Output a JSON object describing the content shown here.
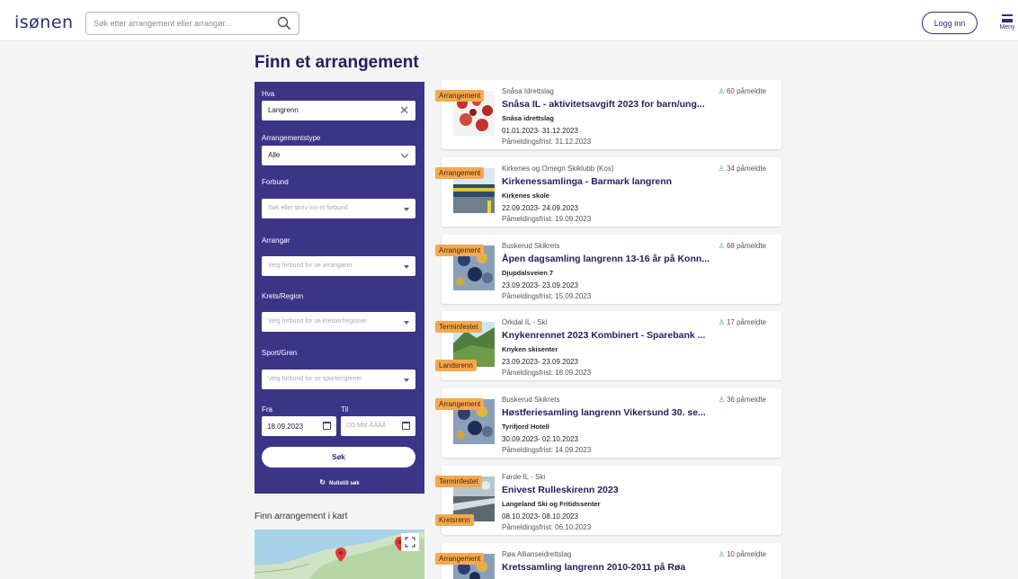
{
  "header": {
    "logo": "isønen",
    "search_placeholder": "Søk etter arrangement eller arrangør...",
    "login_label": "Logg inn",
    "menu_label": "Meny"
  },
  "page": {
    "title": "Finn et arrangement",
    "map_title": "Finn arrangement i kart"
  },
  "filters": {
    "hva_label": "Hva",
    "hva_value": "Langrenn",
    "type_label": "Arrangementstype",
    "type_value": "Alle",
    "forbund_label": "Forbund",
    "forbund_placeholder": "Søk eller skriv inn et forbund",
    "arrangor_label": "Arrangør",
    "arrangor_placeholder": "Velg forbund for se arrangører",
    "krets_label": "Krets/Region",
    "krets_placeholder": "Velg forbund for se kretser/regioner",
    "sport_label": "Sport/Gren",
    "sport_placeholder": "Velg forbund for se sporter/grener",
    "fra_label": "Fra",
    "fra_value": "18.09.2023",
    "til_label": "Til",
    "til_placeholder": "DD.MM.ÅÅÅÅ",
    "search_button": "Søk",
    "reset_label": "Nullstill søk"
  },
  "events": [
    {
      "tag1": "Arrangement",
      "tag2": "",
      "org": "Snåsa Idrettslag",
      "participants": "60 påmeldte",
      "title": "Snåsa IL - aktivitetsavgift 2023 for barn/ung...",
      "venue": "Snåsa idrettslag",
      "dates": "01.01.2023- 31.12.2023",
      "deadline": "Påmeldingsfrist: 31.12.2023"
    },
    {
      "tag1": "Arrangement",
      "tag2": "",
      "org": "Kirkenes og Omegn Skiklubb (Kos)",
      "participants": "34 påmeldte",
      "title": "Kirkenessamlinga - Barmark langrenn",
      "venue": "Kirkenes skole",
      "dates": "22.09.2023- 24.09.2023",
      "deadline": "Påmeldingsfrist: 19.09.2023"
    },
    {
      "tag1": "Arrangement",
      "tag2": "",
      "org": "Buskerud Skikrets",
      "participants": "68 påmeldte",
      "title": "Åpen dagsamling langrenn 13-16 år på Konn...",
      "venue": "Djupdalsveien 7",
      "dates": "23.09.2023- 23.09.2023",
      "deadline": "Påmeldingsfrist: 15.09.2023"
    },
    {
      "tag1": "Terminfestet",
      "tag2": "Landsrenn",
      "org": "Orkdal IL - Ski",
      "participants": "17 påmeldte",
      "title": "Knykenrennet 2023 Kombinert - Sparebank ...",
      "venue": "Knyken skisenter",
      "dates": "23.09.2023- 23.09.2023",
      "deadline": "Påmeldingsfrist: 18.09.2023"
    },
    {
      "tag1": "Arrangement",
      "tag2": "",
      "org": "Buskerud Skikrets",
      "participants": "36 påmeldte",
      "title": "Høstferiesamling langrenn Vikersund 30. se...",
      "venue": "Tyrifjord Hotell",
      "dates": "30.09.2023- 02.10.2023",
      "deadline": "Påmeldingsfrist: 14.09.2023"
    },
    {
      "tag1": "Terminfestet",
      "tag2": "Kretsrenn",
      "org": "Førde IL - Ski",
      "participants": "",
      "title": "Enivest Rulleskirenn 2023",
      "venue": "Langeland Ski og Fritidssenter",
      "dates": "08.10.2023- 08.10.2023",
      "deadline": "Påmeldingsfrist: 06.10.2023"
    },
    {
      "tag1": "Arrangement",
      "tag2": "",
      "org": "Røa Allianseidrettslag",
      "participants": "10 påmeldte",
      "title": "Kretssamling langrenn 2010-2011 på Røa",
      "venue": "",
      "dates": "",
      "deadline": ""
    }
  ],
  "colors": {
    "brand": "#2c2c7a",
    "filter_panel": "#3b3487",
    "tag": "#f6a84f",
    "participant_icon": "#3aa86a"
  }
}
